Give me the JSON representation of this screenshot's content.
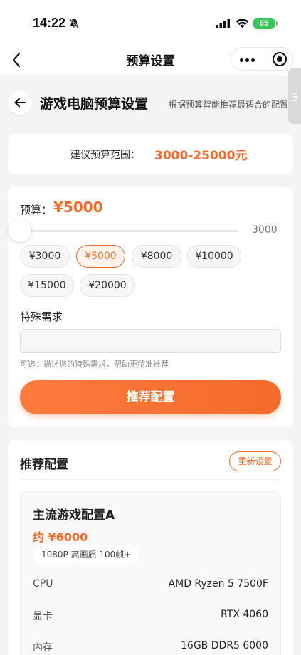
{
  "status_bar": {
    "time": "14:22",
    "battery": "85"
  },
  "nav": {
    "title": "预算设置"
  },
  "header": {
    "title": "游戏电脑预算设置",
    "subtitle": "根据预算智能推荐最适合的配置"
  },
  "range": {
    "label": "建议预算范围：",
    "value": "3000-25000元"
  },
  "budget": {
    "label": "预算：",
    "amount": "¥5000",
    "slider_value": "3000",
    "presets": [
      "¥3000",
      "¥5000",
      "¥8000",
      "¥10000",
      "¥15000",
      "¥20000"
    ],
    "selected": "¥5000"
  },
  "special": {
    "label": "特殊需求",
    "value": "",
    "placeholder": "",
    "hint": "可选：描述您的特殊需求，帮助更精准推荐"
  },
  "recommend_button": "推荐配置",
  "result": {
    "title": "推荐配置",
    "reset_label": "重新设置",
    "config": {
      "name": "主流游戏配置A",
      "price": "约 ¥6000",
      "tag": "1080P 高画质 100帧+",
      "specs": [
        {
          "key": "CPU",
          "value": "AMD Ryzen 5 7500F"
        },
        {
          "key": "显卡",
          "value": "RTX 4060"
        },
        {
          "key": "内存",
          "value": "16GB DDR5 6000"
        }
      ]
    }
  },
  "colors": {
    "accent": "#f26b2a",
    "background": "#f4f4f6",
    "battery": "#34c759"
  }
}
